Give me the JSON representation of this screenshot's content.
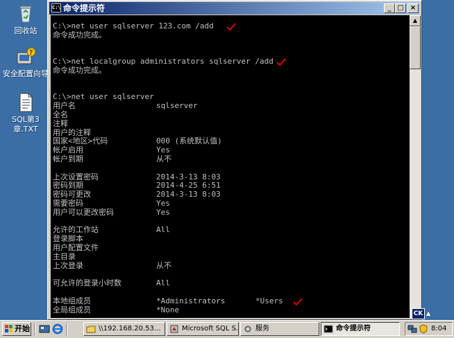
{
  "desktop": {
    "icons": [
      {
        "label": "回收站",
        "icon": "recycle-bin-icon"
      },
      {
        "label": "安全配置向导",
        "icon": "security-wizard-icon"
      },
      {
        "label": "SQL第3章.TXT",
        "icon": "text-file-icon"
      }
    ]
  },
  "window": {
    "title": "命令提示符",
    "icon_text": "C:\\",
    "minimize_label": "_",
    "maximize_label": "□",
    "close_label": "×"
  },
  "console": {
    "lines": [
      {
        "text": "C:\\>net user sqlserver 123.com /add",
        "check": true
      },
      {
        "text": "命令成功完成。"
      },
      {
        "text": ""
      },
      {
        "text": ""
      },
      {
        "text": "C:\\>net localgroup administrators sqlserver /add",
        "check": true
      },
      {
        "text": "命令成功完成。"
      },
      {
        "text": ""
      },
      {
        "text": ""
      },
      {
        "text": "C:\\>net user sqlserver"
      },
      {
        "text": "用户名",
        "value": "sqlserver"
      },
      {
        "text": "全名",
        "value": ""
      },
      {
        "text": "注释",
        "value": ""
      },
      {
        "text": "用户的注释",
        "value": ""
      },
      {
        "text": "国家<地区>代码",
        "value": "000 (系统默认值)"
      },
      {
        "text": "帐户启用",
        "value": "Yes"
      },
      {
        "text": "帐户到期",
        "value": "从不"
      },
      {
        "text": ""
      },
      {
        "text": "上次设置密码",
        "value": "2014-3-13 8:03"
      },
      {
        "text": "密码到期",
        "value": "2014-4-25 6:51"
      },
      {
        "text": "密码可更改",
        "value": "2014-3-13 8:03"
      },
      {
        "text": "需要密码",
        "value": "Yes"
      },
      {
        "text": "用户可以更改密码",
        "value": "Yes"
      },
      {
        "text": ""
      },
      {
        "text": "允许的工作站",
        "value": "All"
      },
      {
        "text": "登录脚本",
        "value": ""
      },
      {
        "text": "用户配置文件",
        "value": ""
      },
      {
        "text": "主目录",
        "value": ""
      },
      {
        "text": "上次登录",
        "value": "从不"
      },
      {
        "text": ""
      },
      {
        "text": "可允许的登录小时数",
        "value": "All"
      },
      {
        "text": ""
      },
      {
        "text": "本地组成员",
        "value": "*Administrators",
        "value2": "*Users",
        "check": true
      },
      {
        "text": "全局组成员",
        "value": "*None"
      }
    ]
  },
  "ime": {
    "label": "CK"
  },
  "taskbar": {
    "start_label": "开始",
    "quick_launch": [
      "show-desktop-icon",
      "internet-explorer-icon"
    ],
    "tasks": [
      {
        "label": "\\\\192.168.20.53...",
        "icon": "folder-icon",
        "active": false
      },
      {
        "label": "Microsoft SQL S...",
        "icon": "sql-server-icon",
        "active": false
      },
      {
        "label": "服务",
        "icon": "services-icon",
        "active": false
      },
      {
        "label": "命令提示符",
        "icon": "cmd-icon",
        "active": true
      }
    ],
    "tray_icons": [
      "network-icon",
      "security-shield-icon"
    ],
    "clock": "8:04"
  },
  "colors": {
    "desktop": "#3a6ea5",
    "console_bg": "#000000",
    "console_fg": "#c0c0c0",
    "check_mark": "#e00000",
    "title_bar_start": "#0a246a",
    "title_bar_end": "#a6caf0"
  }
}
